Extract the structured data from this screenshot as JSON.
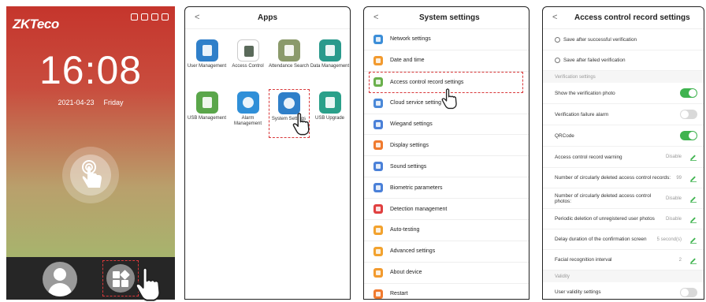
{
  "home": {
    "brand": "ZKTeco",
    "time": "16:08",
    "date": "2021-04-23",
    "weekday": "Friday"
  },
  "apps": {
    "title": "Apps",
    "items": [
      {
        "label": "User Management",
        "icon": "user-management-icon",
        "color": "#2f7fc9"
      },
      {
        "label": "Access Control",
        "icon": "door-icon",
        "color": "#ffffff"
      },
      {
        "label": "Attendance Search",
        "icon": "attendance-icon",
        "color": "#8b9a6b"
      },
      {
        "label": "Data Management",
        "icon": "database-icon",
        "color": "#2a9a8c"
      },
      {
        "label": "USB Management",
        "icon": "usb-drive-icon",
        "color": "#5aa64a"
      },
      {
        "label": "Alarm Management",
        "icon": "clock-icon",
        "color": "#2f8fd8"
      },
      {
        "label": "System Settings",
        "icon": "gear-icon",
        "color": "#2f7fc9"
      },
      {
        "label": "USB Upgrade",
        "icon": "usb-upgrade-icon",
        "color": "#2aa08a"
      }
    ]
  },
  "system": {
    "title": "System settings",
    "items": [
      {
        "label": "Network settings",
        "color": "#3c8ed8"
      },
      {
        "label": "Date and time",
        "color": "#f29a2e"
      },
      {
        "label": "Access control record settings",
        "color": "#6ab04c"
      },
      {
        "label": "Cloud service setting",
        "color": "#4a88d8"
      },
      {
        "label": "Wiegand settings",
        "color": "#4a80d8"
      },
      {
        "label": "Display settings",
        "color": "#f07a2e"
      },
      {
        "label": "Sound settings",
        "color": "#4a80d8"
      },
      {
        "label": "Biometric parameters",
        "color": "#4a80d8"
      },
      {
        "label": "Detection management",
        "color": "#e04040"
      },
      {
        "label": "Auto-testing",
        "color": "#f2a22e"
      },
      {
        "label": "Advanced settings",
        "color": "#f2a22e"
      },
      {
        "label": "About device",
        "color": "#f29a2e"
      },
      {
        "label": "Restart",
        "color": "#f07a2e"
      }
    ]
  },
  "acr": {
    "title": "Access control record settings",
    "save_success": "Save after successful verification",
    "save_failed": "Save after failed verification",
    "section_verification": "Verification settings",
    "show_photo": "Show the verification photo",
    "failure_alarm": "Verification failure alarm",
    "qrcode": "QRCode",
    "record_warning": "Access control record warning",
    "record_warning_value": "Disable",
    "deleted_records": "Number of circularly deleted access control records:",
    "deleted_records_value": "99",
    "deleted_photos": "Number of circularly deleted access control photos:",
    "deleted_photos_value": "Disable",
    "periodic_deletion": "Periodic deletion of unregistered user photos",
    "periodic_deletion_value": "Disable",
    "delay_duration": "Delay duration of the confirmation screen",
    "delay_duration_value": "5 second(s)",
    "face_interval": "Facial recognition interval",
    "face_interval_value": "2",
    "section_validity": "Validity",
    "user_validity": "User validity settings",
    "toggles": {
      "show_photo": true,
      "failure_alarm": false,
      "qrcode": true,
      "user_validity": false
    },
    "accent": "#3fb34f"
  }
}
